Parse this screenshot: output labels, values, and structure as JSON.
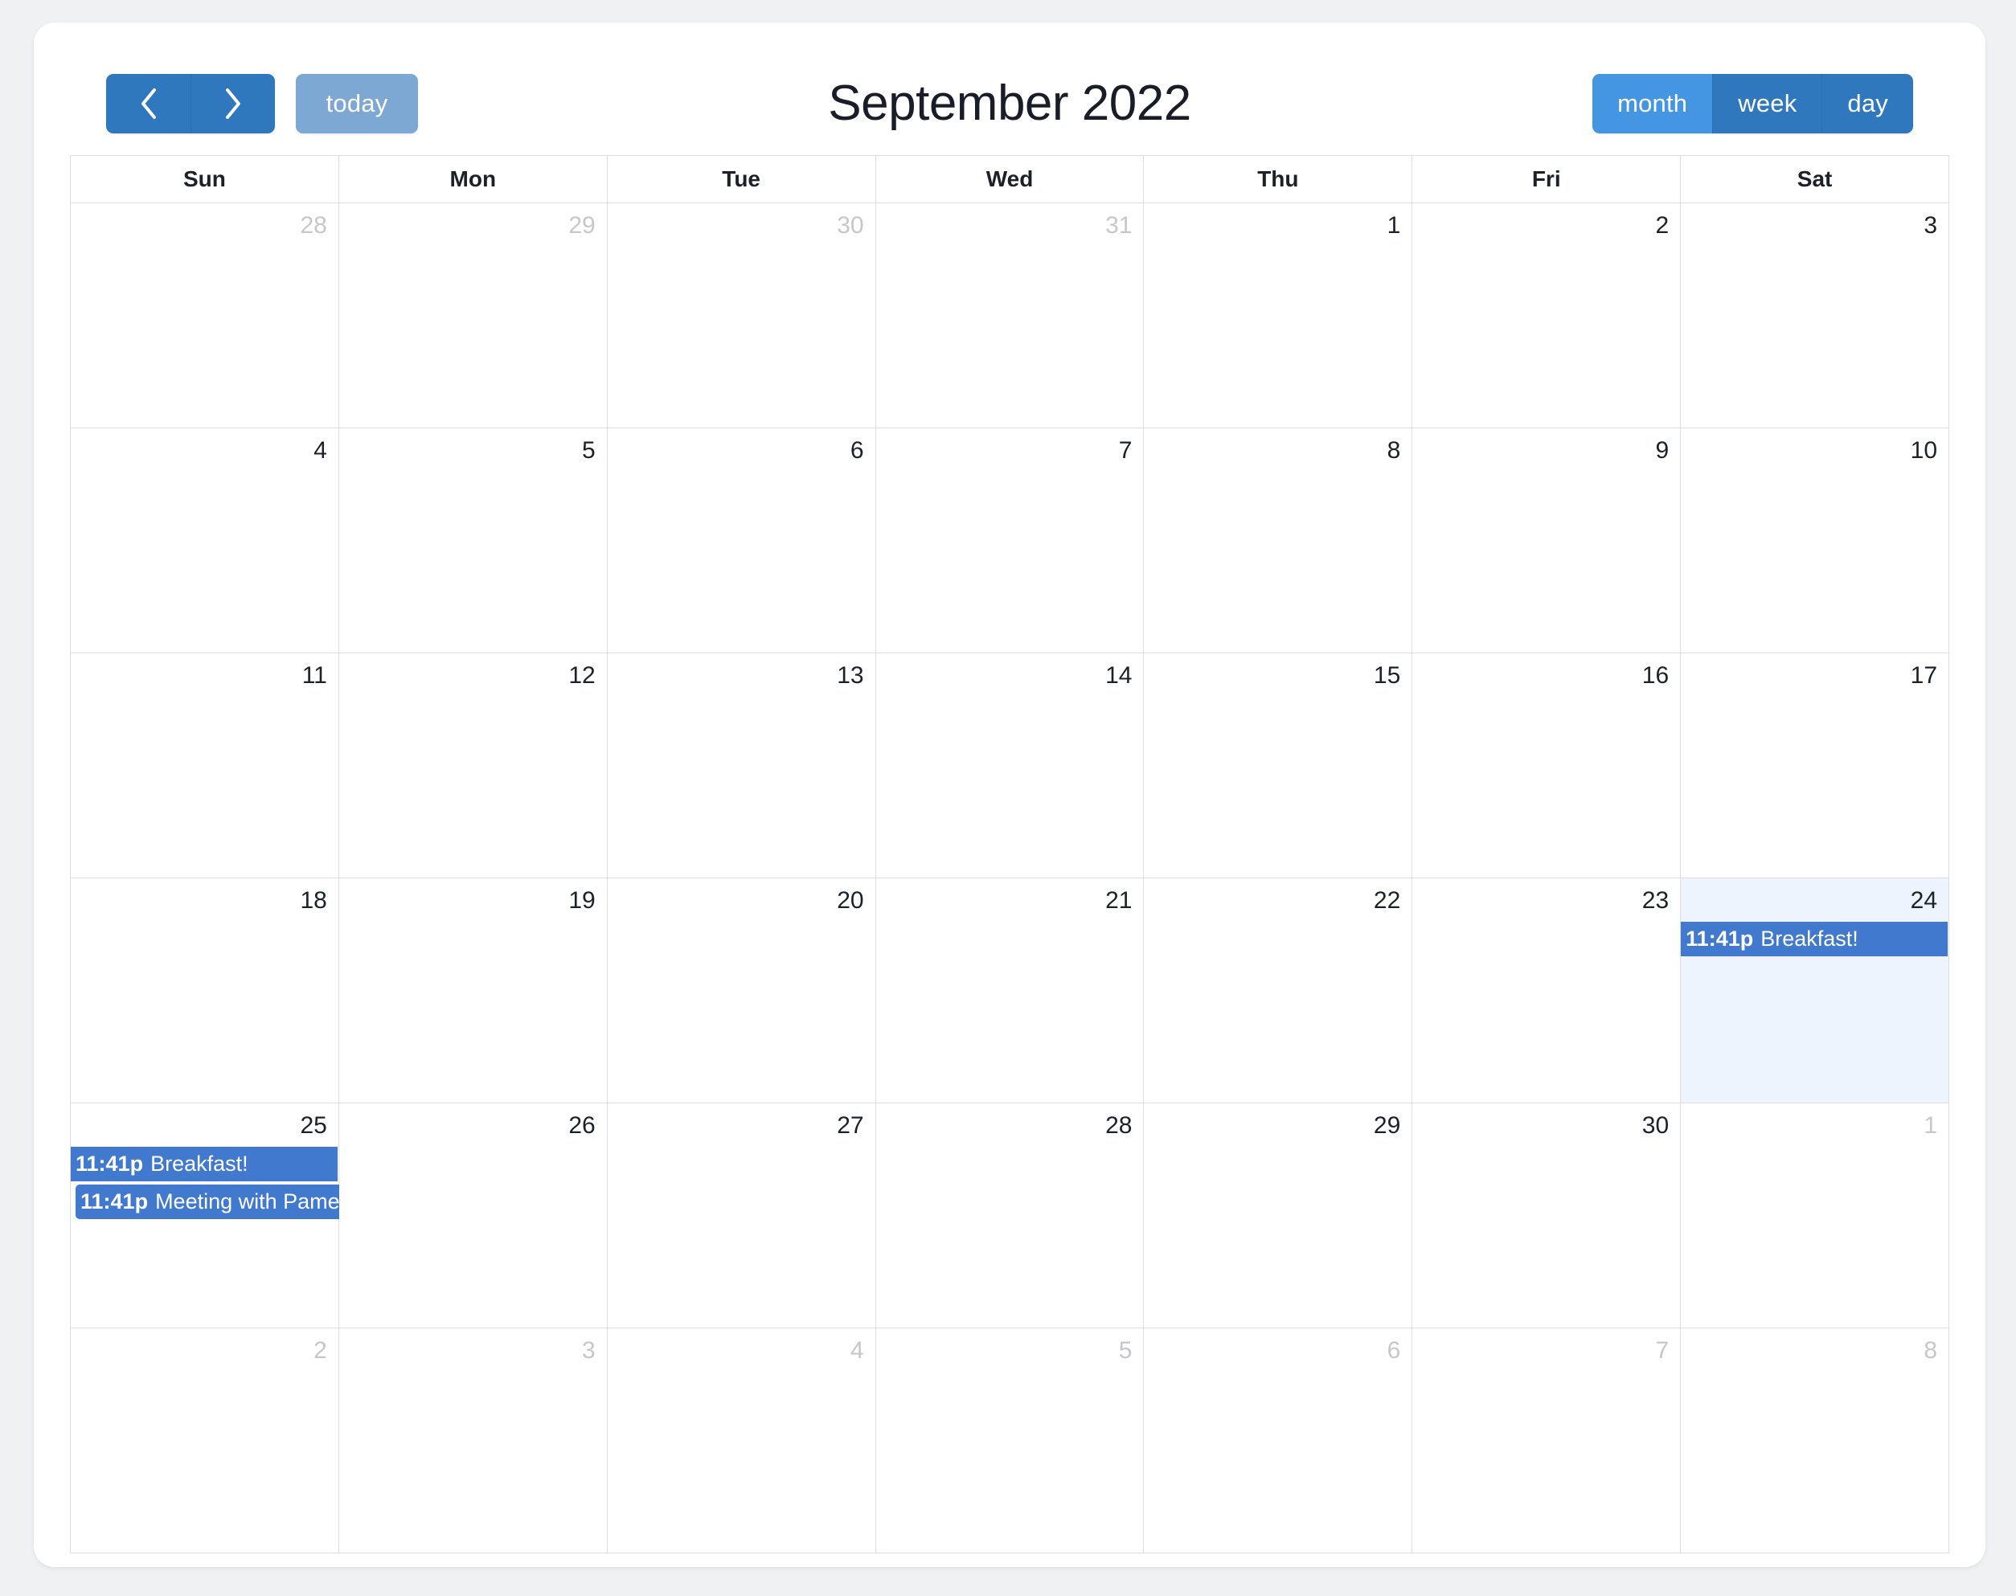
{
  "toolbar": {
    "prev_label": "prev",
    "next_label": "next",
    "today_label": "today",
    "title": "September 2022",
    "views": [
      {
        "label": "month",
        "active": true
      },
      {
        "label": "week",
        "active": false
      },
      {
        "label": "day",
        "active": false
      }
    ]
  },
  "colors": {
    "page_background": "#eff1f3",
    "card_background": "#ffffff",
    "nav_button": "#2f78bd",
    "today_button": "#7ea8d4",
    "view_active": "#4495e2",
    "view_inactive": "#2f78bd",
    "event": "#4179ce",
    "today_cell": "#edf4fd",
    "grid_border": "#dddddd",
    "text_dark": "#1c2129",
    "text_muted": "#c5c7ca"
  },
  "weekdays": [
    "Sun",
    "Mon",
    "Tue",
    "Wed",
    "Thu",
    "Fri",
    "Sat"
  ],
  "weeks": [
    [
      {
        "num": "28",
        "other": true
      },
      {
        "num": "29",
        "other": true
      },
      {
        "num": "30",
        "other": true
      },
      {
        "num": "31",
        "other": true
      },
      {
        "num": "1",
        "other": false
      },
      {
        "num": "2",
        "other": false
      },
      {
        "num": "3",
        "other": false
      }
    ],
    [
      {
        "num": "4",
        "other": false
      },
      {
        "num": "5",
        "other": false
      },
      {
        "num": "6",
        "other": false
      },
      {
        "num": "7",
        "other": false
      },
      {
        "num": "8",
        "other": false
      },
      {
        "num": "9",
        "other": false
      },
      {
        "num": "10",
        "other": false
      }
    ],
    [
      {
        "num": "11",
        "other": false
      },
      {
        "num": "12",
        "other": false
      },
      {
        "num": "13",
        "other": false
      },
      {
        "num": "14",
        "other": false
      },
      {
        "num": "15",
        "other": false
      },
      {
        "num": "16",
        "other": false
      },
      {
        "num": "17",
        "other": false
      }
    ],
    [
      {
        "num": "18",
        "other": false
      },
      {
        "num": "19",
        "other": false
      },
      {
        "num": "20",
        "other": false
      },
      {
        "num": "21",
        "other": false
      },
      {
        "num": "22",
        "other": false
      },
      {
        "num": "23",
        "other": false
      },
      {
        "num": "24",
        "other": false,
        "today": true,
        "events": [
          {
            "time": "11:41p",
            "title": "Breakfast!",
            "span": 1,
            "style": "flush",
            "row": 0
          }
        ]
      }
    ],
    [
      {
        "num": "25",
        "other": false,
        "events": [
          {
            "time": "11:41p",
            "title": "Breakfast!",
            "span": 1,
            "style": "flush",
            "row": 0
          },
          {
            "time": "11:41p",
            "title": "Meeting with Pamela",
            "span": 2,
            "style": "inset",
            "row": 1
          }
        ]
      },
      {
        "num": "26",
        "other": false
      },
      {
        "num": "27",
        "other": false
      },
      {
        "num": "28",
        "other": false
      },
      {
        "num": "29",
        "other": false
      },
      {
        "num": "30",
        "other": false
      },
      {
        "num": "1",
        "other": true
      }
    ],
    [
      {
        "num": "2",
        "other": true
      },
      {
        "num": "3",
        "other": true
      },
      {
        "num": "4",
        "other": true
      },
      {
        "num": "5",
        "other": true
      },
      {
        "num": "6",
        "other": true
      },
      {
        "num": "7",
        "other": true
      },
      {
        "num": "8",
        "other": true
      }
    ]
  ]
}
